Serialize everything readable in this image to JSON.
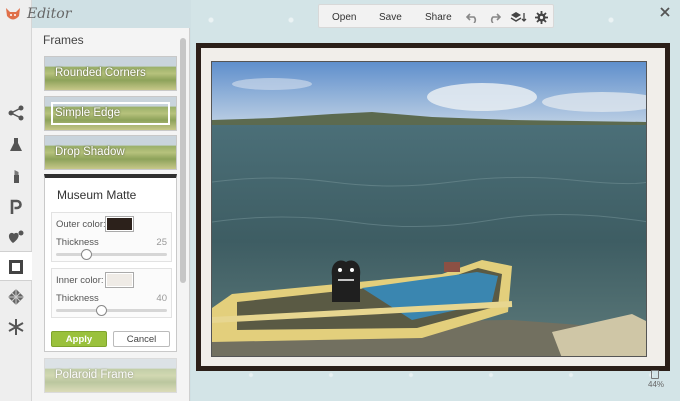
{
  "app": {
    "title": "Editor"
  },
  "panel": {
    "title": "Frames",
    "effects": [
      {
        "label": "Rounded Corners"
      },
      {
        "label": "Simple Edge"
      },
      {
        "label": "Drop Shadow"
      },
      {
        "label": "Polaroid Frame"
      }
    ],
    "settings": {
      "title": "Museum Matte",
      "outer_color_label": "Outer color:",
      "outer_color": "#2c211b",
      "thickness_label": "Thickness",
      "outer_thickness": "25",
      "outer_thickness_max": 100,
      "inner_color_label": "Inner color:",
      "inner_color": "#efebe6",
      "inner_thickness_label": "Thickness",
      "inner_thickness": "40",
      "inner_thickness_max": 100,
      "apply_label": "Apply",
      "cancel_label": "Cancel"
    }
  },
  "toolbar": {
    "open": "Open",
    "save": "Save",
    "share": "Share",
    "icons": [
      "undo-icon",
      "redo-icon",
      "layers-icon",
      "gear-icon"
    ]
  },
  "rail": {
    "icons": [
      "effects-icon",
      "flask-icon",
      "lipstick-icon",
      "text-icon",
      "heart-stickers-icon",
      "frames-icon",
      "textures-icon",
      "snowflake-icon"
    ]
  },
  "stage": {
    "zoom": "44%"
  }
}
